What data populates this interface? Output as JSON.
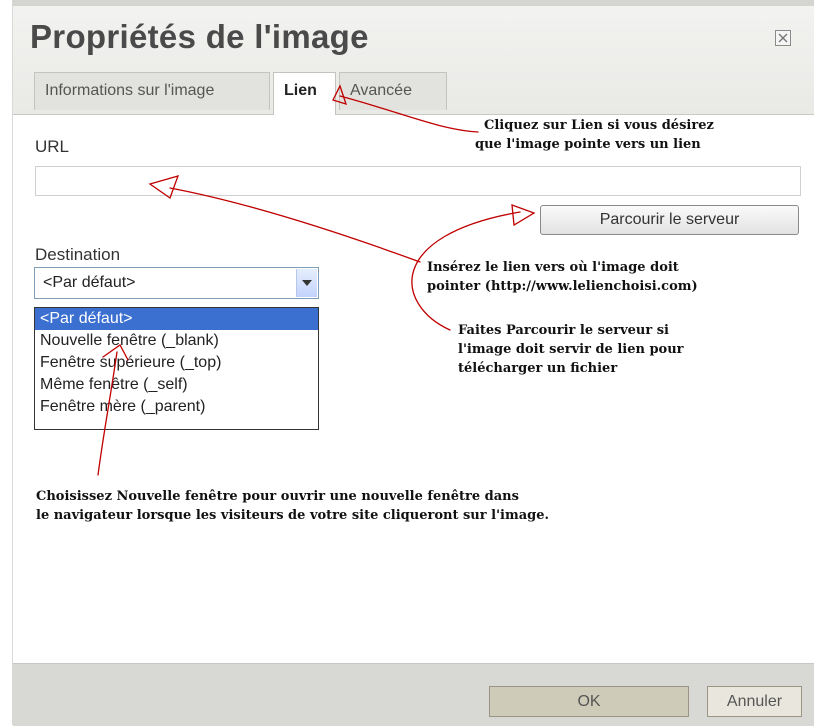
{
  "dialog": {
    "title": "Propriétés de l'image",
    "tabs": [
      {
        "label": "Informations sur l'image",
        "active": false
      },
      {
        "label": "Lien",
        "active": true
      },
      {
        "label": "Avancée",
        "active": false
      }
    ]
  },
  "url_field": {
    "label": "URL",
    "value": ""
  },
  "browse_button": {
    "label": "Parcourir le serveur"
  },
  "destination": {
    "label": "Destination",
    "selected": "<Par défaut>",
    "options": [
      "<Par défaut>",
      "Nouvelle fenêtre (_blank)",
      "Fenêtre supérieure (_top)",
      "Même fenêtre (_self)",
      "Fenêtre mère (_parent)"
    ]
  },
  "buttons": {
    "ok": "OK",
    "cancel": "Annuler"
  },
  "annotations": {
    "lien_line1": "Cliquez sur Lien si vous désirez",
    "lien_line2": "que l'image pointe vers un lien",
    "url_line1": "Insérez le lien vers où l'image doit",
    "url_line2": "pointer (http://www.lelienchoisi.com)",
    "browse_line1": "Faites Parcourir le serveur si",
    "browse_line2": "l'image doit servir de lien pour",
    "browse_line3": "télécharger un fichier",
    "window_line1": "Choisissez Nouvelle fenêtre pour ouvrir une nouvelle fenêtre dans",
    "window_line2": "le navigateur lorsque les visiteurs de votre site cliqueront sur l'image."
  },
  "colors": {
    "annotation_arrow": "#c00000",
    "selected_option": "#3b6fd0"
  }
}
